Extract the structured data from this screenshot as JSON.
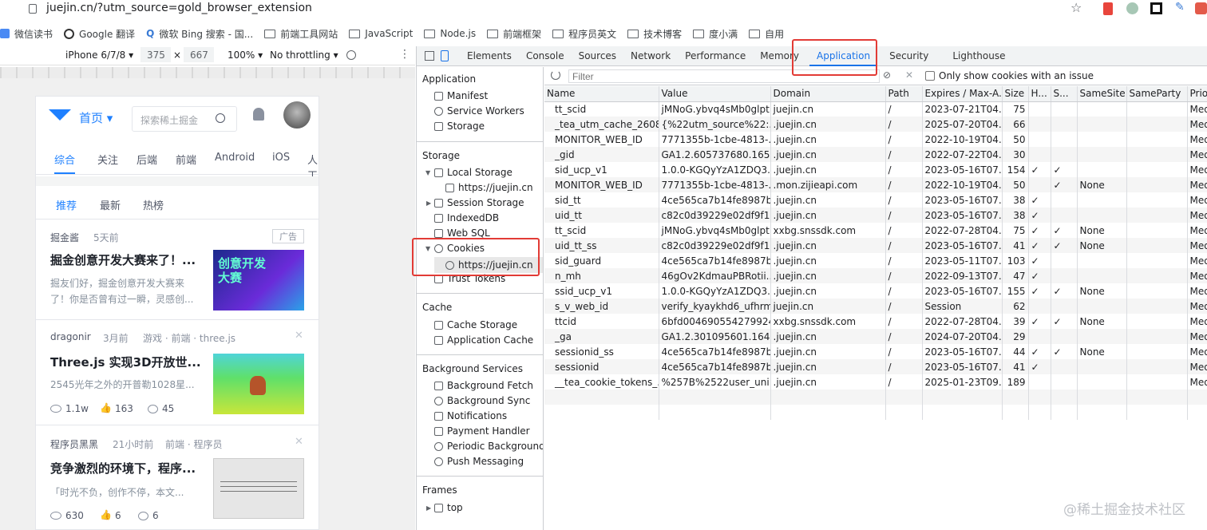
{
  "browser": {
    "url": "juejin.cn/?utm_source=gold_browser_extension",
    "bookmarks": [
      "微信读书",
      "Google 翻译",
      "微软 Bing 搜索 - 国...",
      "前端工具网站",
      "JavaScript",
      "Node.js",
      "前端框架",
      "程序员英文",
      "技术博客",
      "度小满",
      "自用"
    ]
  },
  "device": {
    "model": "iPhone 6/7/8 ▾",
    "width": "375",
    "x": "×",
    "height": "667",
    "zoom": "100% ▾",
    "throttle": "No throttling ▾"
  },
  "page": {
    "nav": {
      "home": "首页 ▾",
      "search_placeholder": "探索稀土掘金"
    },
    "tabs": [
      "综合",
      "关注",
      "后端",
      "前端",
      "Android",
      "iOS",
      "人工"
    ],
    "subtabs": [
      "推荐",
      "最新",
      "热榜"
    ],
    "articles": [
      {
        "author": "掘金酱",
        "time": "5天前",
        "tag": "广告",
        "title": "掘金创意开发大赛来了！...",
        "summary": "掘友们好，掘金创意开发大赛来了！你是否曾有过一瞬，灵感创...",
        "thumb": "创意开发大赛",
        "views": "",
        "likes": "",
        "comments": ""
      },
      {
        "author": "dragonir",
        "time": "3月前",
        "tag": "游戏 · 前端 · three.js",
        "title": "Three.js 实现3D开放世...",
        "summary": "2545光年之外的开普勒1028星...",
        "views": "1.1w",
        "likes": "163",
        "comments": "45"
      },
      {
        "author": "程序员黑黑",
        "time": "21小时前",
        "tag": "前端 · 程序员",
        "title": "竞争激烈的环境下，程序...",
        "summary": "「时光不负，创作不停，本文...",
        "views": "630",
        "likes": "6",
        "comments": "6"
      }
    ]
  },
  "devtools": {
    "tabs": [
      "Elements",
      "Console",
      "Sources",
      "Network",
      "Performance",
      "Memory",
      "Application",
      "Security",
      "Lighthouse"
    ],
    "active_tab": "Application",
    "sidebar": {
      "application": {
        "title": "Application",
        "items": [
          "Manifest",
          "Service Workers",
          "Storage"
        ]
      },
      "storage": {
        "title": "Storage",
        "items": [
          "Local Storage",
          "https://juejin.cn",
          "Session Storage",
          "IndexedDB",
          "Web SQL",
          "Cookies",
          "https://juejin.cn",
          "Trust Tokens"
        ]
      },
      "cache": {
        "title": "Cache",
        "items": [
          "Cache Storage",
          "Application Cache"
        ]
      },
      "bg": {
        "title": "Background Services",
        "items": [
          "Background Fetch",
          "Background Sync",
          "Notifications",
          "Payment Handler",
          "Periodic Background Sync",
          "Push Messaging"
        ]
      },
      "frames": {
        "title": "Frames",
        "items": [
          "top"
        ]
      }
    },
    "filter": {
      "placeholder": "Filter",
      "only_issue": "Only show cookies with an issue"
    },
    "columns": [
      "Name",
      "Value",
      "Domain",
      "Path",
      "Expires / Max-A...",
      "Size",
      "H...",
      "S...",
      "SameSite",
      "SameParty",
      "Priority"
    ],
    "rows": [
      [
        "tt_scid",
        "jMNoG.ybvq4sMb0glpt...",
        "juejin.cn",
        "/",
        "2023-07-21T04...",
        "75",
        "",
        "",
        "",
        "",
        "Medium"
      ],
      [
        "_tea_utm_cache_2608",
        "{%22utm_source%22:...",
        ".juejin.cn",
        "/",
        "2025-07-20T04...",
        "66",
        "",
        "",
        "",
        "",
        "Medium"
      ],
      [
        "MONITOR_WEB_ID",
        "7771355b-1cbe-4813-...",
        ".juejin.cn",
        "/",
        "2022-10-19T04...",
        "50",
        "",
        "",
        "",
        "",
        "Medium"
      ],
      [
        "_gid",
        "GA1.2.605737680.1657...",
        ".juejin.cn",
        "/",
        "2022-07-22T04...",
        "30",
        "",
        "",
        "",
        "",
        "Medium"
      ],
      [
        "sid_ucp_v1",
        "1.0.0-KGQyYzA1ZDQ3...",
        ".juejin.cn",
        "/",
        "2023-05-16T07...",
        "154",
        "✓",
        "✓",
        "",
        "",
        "Medium"
      ],
      [
        "MONITOR_WEB_ID",
        "7771355b-1cbe-4813-...",
        ".mon.zijieapi.com",
        "/",
        "2022-10-19T04...",
        "50",
        "",
        "✓",
        "None",
        "",
        "Medium"
      ],
      [
        "sid_tt",
        "4ce565ca7b14fe8987b...",
        ".juejin.cn",
        "/",
        "2023-05-16T07...",
        "38",
        "✓",
        "",
        "",
        "",
        "Medium"
      ],
      [
        "uid_tt",
        "c82c0d39229e02df9f1...",
        ".juejin.cn",
        "/",
        "2023-05-16T07...",
        "38",
        "✓",
        "",
        "",
        "",
        "Medium"
      ],
      [
        "tt_scid",
        "jMNoG.ybvq4sMb0glpt...",
        "xxbg.snssdk.com",
        "/",
        "2022-07-28T04...",
        "75",
        "✓",
        "✓",
        "None",
        "",
        "Medium"
      ],
      [
        "uid_tt_ss",
        "c82c0d39229e02df9f1...",
        ".juejin.cn",
        "/",
        "2023-05-16T07...",
        "41",
        "✓",
        "✓",
        "None",
        "",
        "Medium"
      ],
      [
        "sid_guard",
        "4ce565ca7b14fe8987b...",
        ".juejin.cn",
        "/",
        "2023-05-11T07...",
        "103",
        "✓",
        "",
        "",
        "",
        "Medium"
      ],
      [
        "n_mh",
        "46gOv2KdmauPBRotii...",
        ".juejin.cn",
        "/",
        "2022-09-13T07...",
        "47",
        "✓",
        "",
        "",
        "",
        "Medium"
      ],
      [
        "ssid_ucp_v1",
        "1.0.0-KGQyYzA1ZDQ3...",
        ".juejin.cn",
        "/",
        "2023-05-16T07...",
        "155",
        "✓",
        "✓",
        "None",
        "",
        "Medium"
      ],
      [
        "s_v_web_id",
        "verify_kyaykhd6_ufhrm...",
        "juejin.cn",
        "/",
        "Session",
        "62",
        "",
        "",
        "",
        "",
        "Medium"
      ],
      [
        "ttcid",
        "6bfd004690554279924...",
        "xxbg.snssdk.com",
        "/",
        "2022-07-28T04...",
        "39",
        "✓",
        "✓",
        "None",
        "",
        "Medium"
      ],
      [
        "_ga",
        "GA1.2.301095601.1641...",
        ".juejin.cn",
        "/",
        "2024-07-20T04...",
        "29",
        "",
        "",
        "",
        "",
        "Medium"
      ],
      [
        "sessionid_ss",
        "4ce565ca7b14fe8987b...",
        ".juejin.cn",
        "/",
        "2023-05-16T07...",
        "44",
        "✓",
        "✓",
        "None",
        "",
        "Medium"
      ],
      [
        "sessionid",
        "4ce565ca7b14fe8987b...",
        ".juejin.cn",
        "/",
        "2023-05-16T07...",
        "41",
        "✓",
        "",
        "",
        "",
        "Medium"
      ],
      [
        "__tea_cookie_tokens_...",
        "%257B%2522user_uni...",
        ".juejin.cn",
        "/",
        "2025-01-23T09...",
        "189",
        "",
        "",
        "",
        "",
        "Medium"
      ]
    ]
  },
  "watermark": "@稀土掘金技术社区",
  "colors": {
    "accent": "#1a73e8",
    "juejin_blue": "#1e80ff",
    "highlight": "#e23b35"
  }
}
